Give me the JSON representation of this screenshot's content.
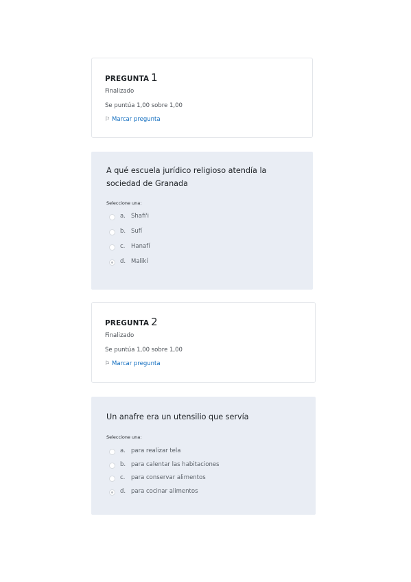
{
  "questions": [
    {
      "label": "PREGUNTA",
      "number": "1",
      "state": "Finalizado",
      "grade": "Se puntúa 1,00 sobre 1,00",
      "flag_label": "Marcar pregunta",
      "text": "A qué escuela jurídico religioso atendía la sociedad de Granada",
      "prompt": "Seleccione una:",
      "answers": [
        {
          "letter": "a.",
          "text": "Shafi'i",
          "selected": false
        },
        {
          "letter": "b.",
          "text": "Sufí",
          "selected": false
        },
        {
          "letter": "c.",
          "text": "Hanafí",
          "selected": false
        },
        {
          "letter": "d.",
          "text": "Malikí",
          "selected": true
        }
      ]
    },
    {
      "label": "PREGUNTA",
      "number": "2",
      "state": "Finalizado",
      "grade": "Se puntúa 1,00 sobre 1,00",
      "flag_label": "Marcar pregunta",
      "text": "Un anafre era un utensilio que servía",
      "prompt": "Seleccione una:",
      "answers": [
        {
          "letter": "a.",
          "text": "para realizar tela",
          "selected": false
        },
        {
          "letter": "b.",
          "text": "para calentar las habitaciones",
          "selected": false
        },
        {
          "letter": "c.",
          "text": "para conservar alimentos",
          "selected": false
        },
        {
          "letter": "d.",
          "text": "para cocinar alimentos",
          "selected": true
        }
      ]
    }
  ],
  "icons": {
    "flag_icon": "flag-icon",
    "radio_icon": "radio-button"
  }
}
